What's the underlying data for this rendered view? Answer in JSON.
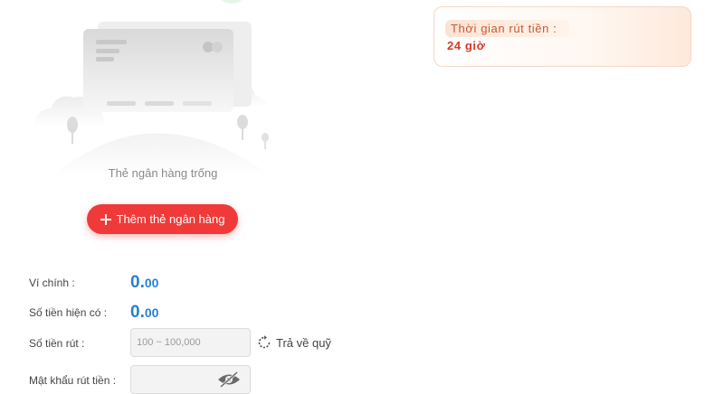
{
  "bank_card": {
    "empty_text": "Thẻ ngân hàng trống",
    "add_button_label": "Thêm thẻ ngân hàng"
  },
  "withdraw_time": {
    "label": "Thời gian rút tiền :",
    "value": "24 giờ"
  },
  "form": {
    "main_wallet_label": "Ví chính :",
    "main_wallet_int": "0.",
    "main_wallet_dec": "00",
    "available_label": "Số tiền hiện có :",
    "available_int": "0.",
    "available_dec": "00",
    "amount_label": "Số tiền rút :",
    "amount_placeholder": "100 ~ 100,000",
    "amount_value": "",
    "return_fund_label": "Trả về quỹ",
    "password_label": "Mật khẩu rút tiền :"
  },
  "colors": {
    "accent_red": "#f03a3a",
    "balance_blue": "#2a7fd0",
    "time_orange": "#c65a34"
  },
  "icons": [
    "plus-icon",
    "refresh-icon",
    "eye-slash-icon",
    "bank-card-illustration"
  ]
}
